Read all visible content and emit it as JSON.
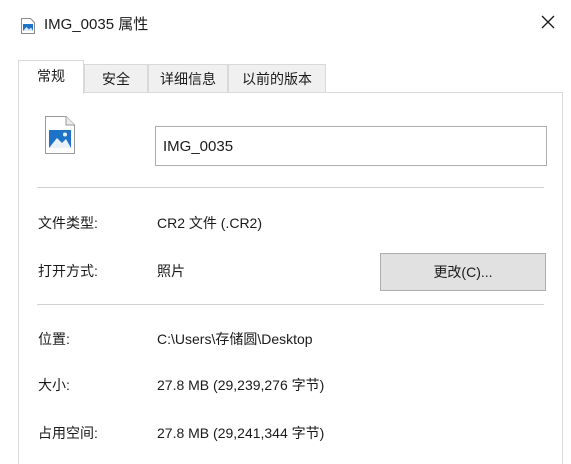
{
  "window": {
    "title": "IMG_0035 属性",
    "close_icon": "close-icon"
  },
  "tabs": [
    {
      "label": "常规",
      "active": true
    },
    {
      "label": "安全",
      "active": false
    },
    {
      "label": "详细信息",
      "active": false
    },
    {
      "label": "以前的版本",
      "active": false
    }
  ],
  "general": {
    "file_icon": "image-file-icon",
    "file_name": "IMG_0035",
    "file_type": {
      "label": "文件类型:",
      "value": "CR2 文件 (.CR2)"
    },
    "opens_with": {
      "label": "打开方式:",
      "value": "照片",
      "button_label": "更改(C)..."
    },
    "location": {
      "label": "位置:",
      "value": "C:\\Users\\存储圆\\Desktop"
    },
    "size": {
      "label": "大小:",
      "value": "27.8 MB (29,239,276 字节)"
    },
    "size_on_disk": {
      "label": "占用空间:",
      "value": "27.8 MB (29,241,344 字节)"
    }
  },
  "colors": {
    "icon_blue": "#1e73c8",
    "button_bg": "#e1e1e1",
    "tab_bg": "#f0f0f0",
    "border": "#d9d9d9"
  }
}
